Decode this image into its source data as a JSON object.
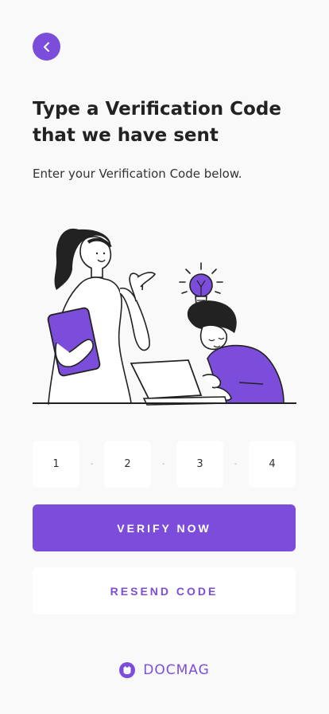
{
  "header": {
    "title": "Type a Verification Code that we have sent",
    "subtitle": "Enter your Verification Code below."
  },
  "code": {
    "digits": [
      "1",
      "2",
      "3",
      "4"
    ],
    "separator": "-"
  },
  "actions": {
    "verify_label": "VERIFY NOW",
    "resend_label": "RESEND CODE"
  },
  "brand": {
    "name": "DOCMAG"
  },
  "icons": {
    "back": "chevron-left-icon",
    "logo": "docmag-logo-icon"
  },
  "colors": {
    "accent": "#7c4ddb",
    "background": "#f9f9f9",
    "text": "#222222"
  }
}
